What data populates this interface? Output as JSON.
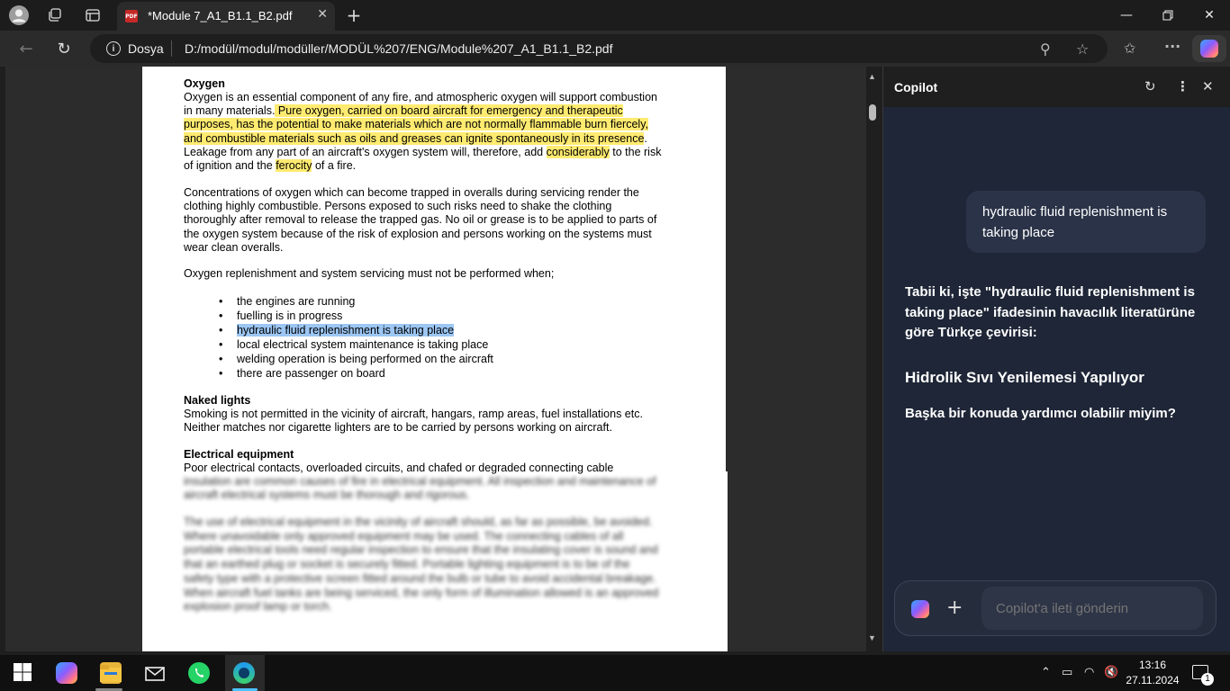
{
  "browser": {
    "tab_title": "*Module 7_A1_B1.1_B2.pdf",
    "address_scheme": "Dosya",
    "url": "D:/modül/modul/modüller/MODÜL%207/ENG/Module%207_A1_B1.1_B2.pdf"
  },
  "document": {
    "heading_oxygen": "Oxygen",
    "p1_a": "Oxygen is an essential component of any fire, and atmospheric oxygen will support combustion",
    "p1_b_plain": "in many materials.",
    "p1_b_hl": " Pure oxygen, carried on board aircraft for emergency and therapeutic",
    "p1_c_hl": "purposes, has the potential to make materials which are not normally flammable burn fiercely,",
    "p1_d_hl": "and combustible materials such as oils and greases can ignite spontaneously in its presence",
    "p1_d_plain": ".",
    "p1_e_plain": "Leakage from any part of an aircraft's oxygen system will, therefore, add",
    "p1_e_hl": "considerably",
    "p1_e_tail": " to the risk",
    "p1_f_plain": "of ignition and the",
    "p1_f_hl": "ferocity",
    "p1_f_tail": " of a fire.",
    "p2_a": "Concentrations of oxygen which can become trapped in overalls during servicing render the",
    "p2_b": "clothing highly combustible. Persons exposed to such risks need to shake the clothing",
    "p2_c": "thoroughly after removal to release the trapped gas. No oil or grease is to be applied to parts of",
    "p2_d": "the oxygen system because of the risk of explosion and persons working on the systems must",
    "p2_e": "wear clean overalls.",
    "p3": "Oxygen replenishment and system servicing must not be performed when;",
    "bullets": [
      "the engines are running",
      "fuelling is in progress",
      "hydraulic fluid replenishment is taking place",
      "local electrical system maintenance is taking place",
      "welding operation is being performed on the aircraft",
      "there are passenger on board"
    ],
    "heading_naked": "Naked lights",
    "p4_a": "Smoking is not permitted in the vicinity of aircraft, hangars, ramp areas, fuel installations etc.",
    "p4_b": "Neither matches nor cigarette lighters are to be carried by persons working on aircraft.",
    "heading_electrical": "Electrical equipment",
    "p5_a": "Poor electrical contacts, overloaded circuits, and chafed or degraded connecting cable",
    "p5_b": "insulation are common causes of fire in electrical equipment. All inspection and maintenance of",
    "p5_c": "aircraft electrical systems must be thorough and rigorous.",
    "p6_a": "The use of electrical equipment in the vicinity of aircraft should, as far as possible, be avoided.",
    "p6_b": "Where unavoidable only approved equipment may be used. The connecting cables of all",
    "p6_c": "portable electrical tools need regular inspection to ensure that the insulating cover is sound and",
    "p6_d": "that an earthed plug or socket is securely fitted. Portable lighting equipment is to be of the",
    "p6_e": "safety type with a protective screen fitted around the bulb or tube to avoid accidental breakage.",
    "p6_f": "When aircraft fuel tanks are being serviced, the only form of illumination allowed is an approved",
    "p6_g": "explosion proof lamp or torch."
  },
  "copilot": {
    "title": "Copilot",
    "user_message": "hydraulic fluid replenishment is taking place",
    "reply_intro": "Tabii ki, işte \"hydraulic fluid replenishment is taking place\" ifadesinin havacılık literatürüne göre Türkçe çevirisi:",
    "reply_translation": "Hidrolik Sıvı Yenilemesi Yapılıyor",
    "reply_followup": "Başka bir konuda yardımcı olabilir miyim?",
    "input_placeholder": "Copilot'a ileti gönderin"
  },
  "taskbar": {
    "time": "13:16",
    "date": "27.11.2024",
    "notification_count": "1"
  }
}
